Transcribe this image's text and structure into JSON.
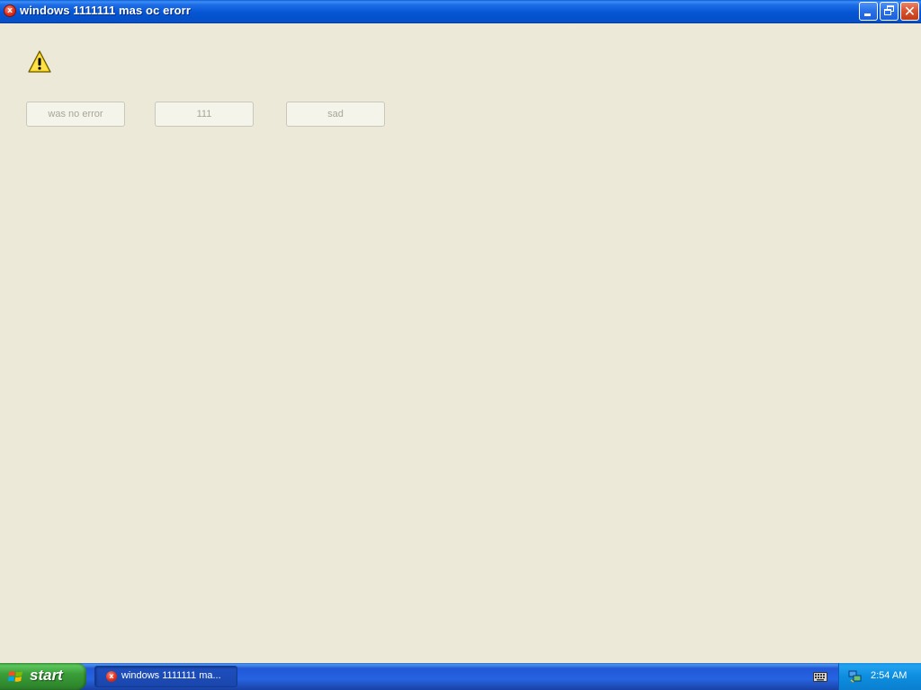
{
  "window": {
    "title": "windows 1111111 mas oc erorr",
    "app_icon": "error-x-icon",
    "controls": {
      "minimize_icon": "minimize-icon",
      "maximize_icon": "restore-icon",
      "close_icon": "close-icon",
      "close_glyph": "✕"
    }
  },
  "dialog": {
    "icon": "warning-icon",
    "buttons": [
      {
        "label": "was no error"
      },
      {
        "label": "111"
      },
      {
        "label": "sad"
      }
    ]
  },
  "taskbar": {
    "start_label": "start",
    "start_icon": "windows-flag-icon",
    "task_item": {
      "label": "windows 1111111 ma...",
      "icon": "error-x-icon"
    },
    "keyboard_icon": "keyboard-icon",
    "tray": {
      "network_icon": "network-icon",
      "clock": "2:54 AM"
    }
  },
  "colors": {
    "titlebar_blue": "#0556d4",
    "client_bg": "#ece9d8",
    "taskbar_blue": "#2157d7",
    "start_green": "#3a9e38",
    "tray_blue": "#0d8ddf",
    "close_red": "#d9552f"
  }
}
